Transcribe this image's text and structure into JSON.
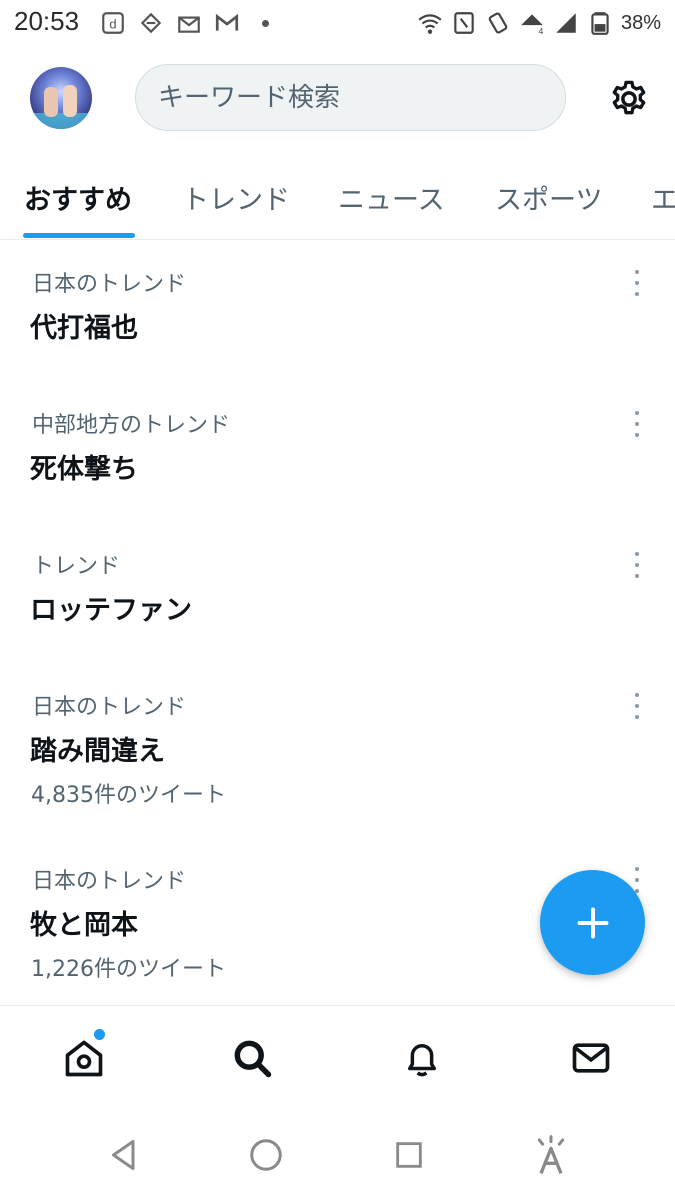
{
  "status_bar": {
    "time": "20:53",
    "battery_percent": "38%",
    "icons_left": [
      "docomo-d-icon",
      "app-icon",
      "mail-icon",
      "gmail-icon",
      "notification-dot"
    ],
    "icons_right": [
      "wifi-icon",
      "nfc-icon",
      "vibrate-icon",
      "lte-signal-icon",
      "cell-signal-icon",
      "battery-icon"
    ]
  },
  "header": {
    "search_placeholder": "キーワード検索",
    "settings_icon": "gear-icon"
  },
  "tabs": [
    {
      "label": "おすすめ",
      "active": true
    },
    {
      "label": "トレンド",
      "active": false
    },
    {
      "label": "ニュース",
      "active": false
    },
    {
      "label": "スポーツ",
      "active": false
    },
    {
      "label": "エ",
      "active": false
    }
  ],
  "trends": [
    {
      "context": "日本のトレンド",
      "name": "代打福也",
      "count": ""
    },
    {
      "context": "中部地方のトレンド",
      "name": "死体撃ち",
      "count": ""
    },
    {
      "context": "トレンド",
      "name": "ロッテファン",
      "count": ""
    },
    {
      "context": "日本のトレンド",
      "name": "踏み間違え",
      "count": "4,835件のツイート"
    },
    {
      "context": "日本のトレンド",
      "name": "牧と岡本",
      "count": "1,226件のツイート"
    }
  ],
  "fab": {
    "icon": "plus-icon"
  },
  "bottom_nav": [
    {
      "icon": "home-icon",
      "has_notification": true
    },
    {
      "icon": "search-icon",
      "active": true
    },
    {
      "icon": "bell-icon"
    },
    {
      "icon": "mail-icon"
    }
  ],
  "system_nav": [
    "back-icon",
    "home-circle-icon",
    "recents-icon",
    "accessibility-icon"
  ],
  "colors": {
    "accent": "#1d9bf0",
    "text_primary": "#0f1419",
    "text_secondary": "#536471"
  }
}
